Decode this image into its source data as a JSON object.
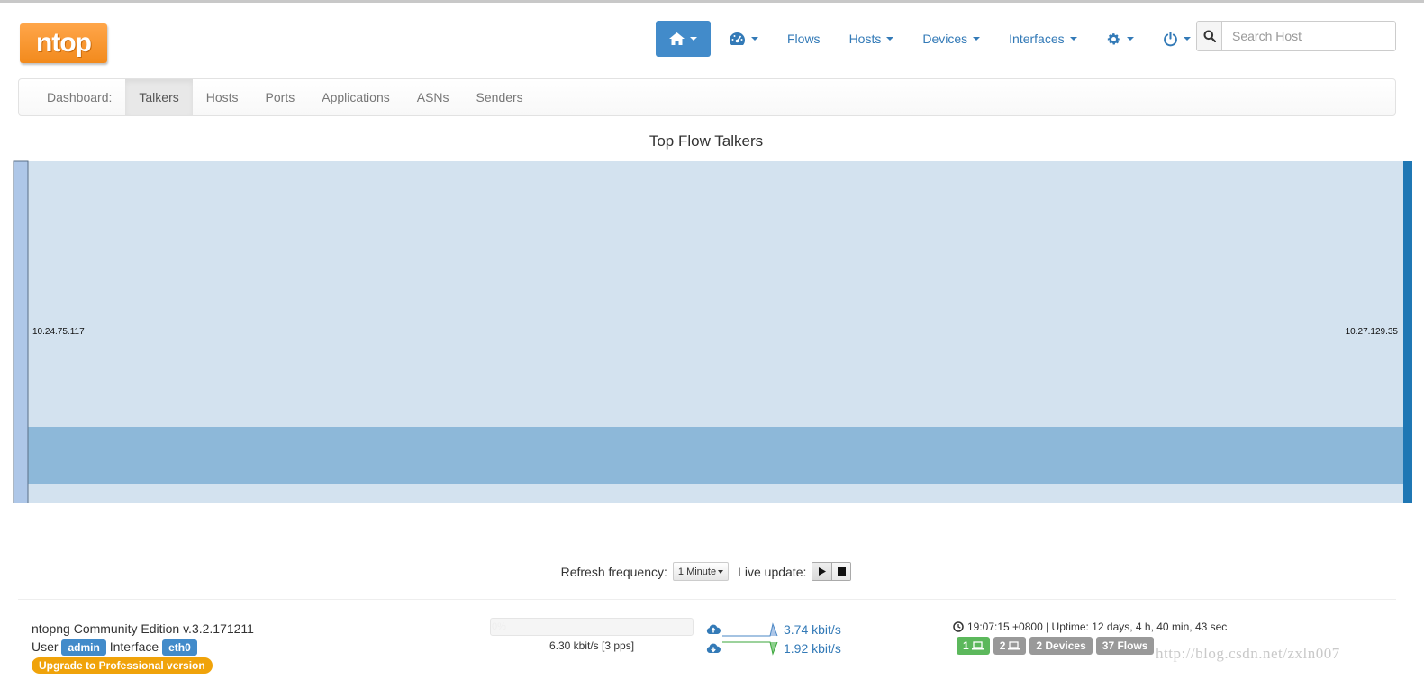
{
  "logo": {
    "text": "ntop"
  },
  "topnav": {
    "flows": "Flows",
    "hosts": "Hosts",
    "devices": "Devices",
    "interfaces": "Interfaces",
    "home_icon": "home-icon",
    "dashboard_icon": "dashboard-gauge-icon",
    "settings_icon": "gear-icon",
    "power_icon": "power-icon"
  },
  "search": {
    "placeholder": "Search Host",
    "icon": "search-icon"
  },
  "subnav": {
    "label": "Dashboard:",
    "tabs": [
      "Talkers",
      "Hosts",
      "Ports",
      "Applications",
      "ASNs",
      "Senders"
    ],
    "active": "Talkers"
  },
  "page": {
    "title": "Top Flow Talkers"
  },
  "talkers": {
    "source": "10.24.75.117",
    "destination": "10.27.129.35"
  },
  "refresh": {
    "label": "Refresh frequency:",
    "value": "1 Minute",
    "live_label": "Live update:"
  },
  "footer": {
    "version": "ntopng Community Edition v.3.2.171211",
    "user_label": "User",
    "user": "admin",
    "interface_label": "Interface",
    "interface": "eth0",
    "upgrade": "Upgrade to Professional version",
    "progress_label": "0%",
    "progress_value": 0,
    "throughput": "6.30 kbit/s [3 pps]",
    "upload_rate": "3.74 kbit/s",
    "download_rate": "1.92 kbit/s",
    "clock": "19:07:15 +0800 | Uptime: 12 days, 4 h, 40 min, 43 sec",
    "local_hosts": "1",
    "remote_hosts": "2",
    "devices": "2 Devices",
    "flows": "37 Flows"
  },
  "colors": {
    "accent": "#428bca",
    "link": "#337ab7",
    "flow_light": "#d3e2ef",
    "flow_dark": "#8db8d9",
    "node_left": "#aec7e8",
    "node_right": "#1f77b4"
  },
  "watermark": "http://blog.csdn.net/zxln007"
}
